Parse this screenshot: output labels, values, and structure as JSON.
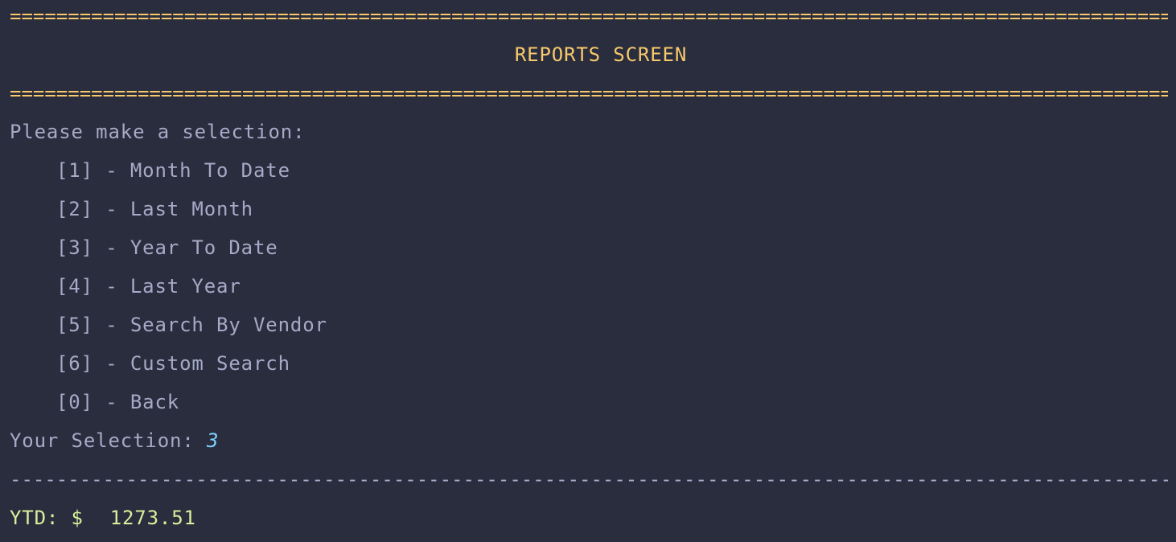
{
  "header": {
    "rule_top": "================================================================================================================================",
    "title": "REPORTS SCREEN",
    "rule_bottom": "================================================================================================================================"
  },
  "prompt": {
    "intro": "Please make a selection:",
    "menu_items": [
      {
        "key": "[1]",
        "label": "Month To Date"
      },
      {
        "key": "[2]",
        "label": "Last Month"
      },
      {
        "key": "[3]",
        "label": "Year To Date"
      },
      {
        "key": "[4]",
        "label": "Last Year"
      },
      {
        "key": "[5]",
        "label": "Search By Vendor"
      },
      {
        "key": "[6]",
        "label": "Custom Search"
      },
      {
        "key": "[0]",
        "label": "Back"
      }
    ],
    "selection_label": "Your Selection: ",
    "selection_value": "3"
  },
  "divider": "--------------------------------------------------------------------------------------------------------------------------------",
  "result": {
    "label": "YTD: $",
    "amount": "1273.51"
  },
  "colors": {
    "background": "#2a2d3e",
    "text": "#a5aac7",
    "accent_yellow": "#f7c96b",
    "input_blue": "#7fd2ff",
    "result_green": "#d6f09b"
  }
}
